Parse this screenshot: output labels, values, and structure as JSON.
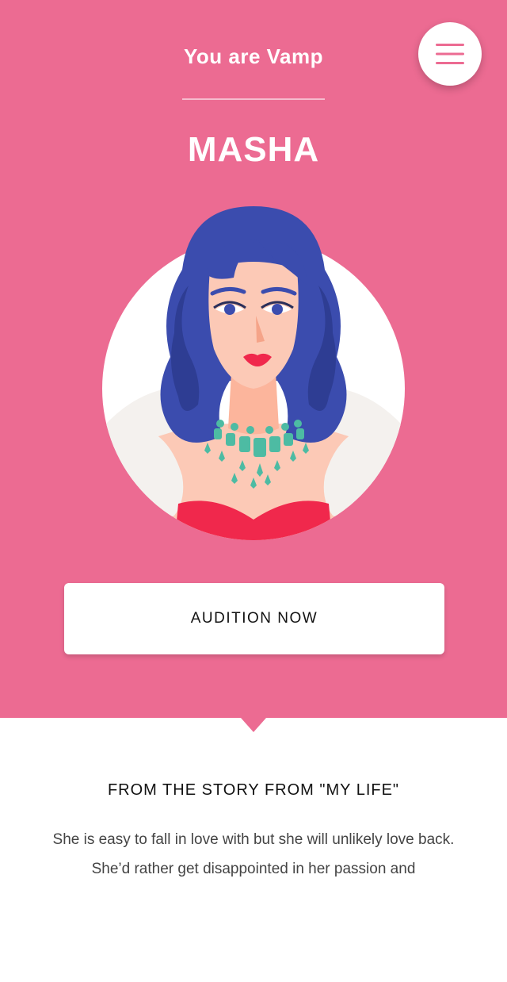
{
  "header": {
    "menu_icon": "hamburger-menu-icon",
    "subtitle": "You are Vamp",
    "name": "MASHA"
  },
  "portrait": {
    "icon": "vamp-character-illustration"
  },
  "cta": {
    "label": "AUDITION NOW"
  },
  "story": {
    "title": "FROM THE STORY FROM \"MY LIFE\"",
    "text": "She is easy to fall in love with but she will unlikely love back. She’d rather get disappointed in her passion and"
  },
  "colors": {
    "brand_pink": "#ec6b92",
    "hair_blue": "#3b4cae",
    "necklace_teal": "#4dbba3",
    "dress_red": "#f0284c",
    "skin": "#fcc9b6"
  }
}
